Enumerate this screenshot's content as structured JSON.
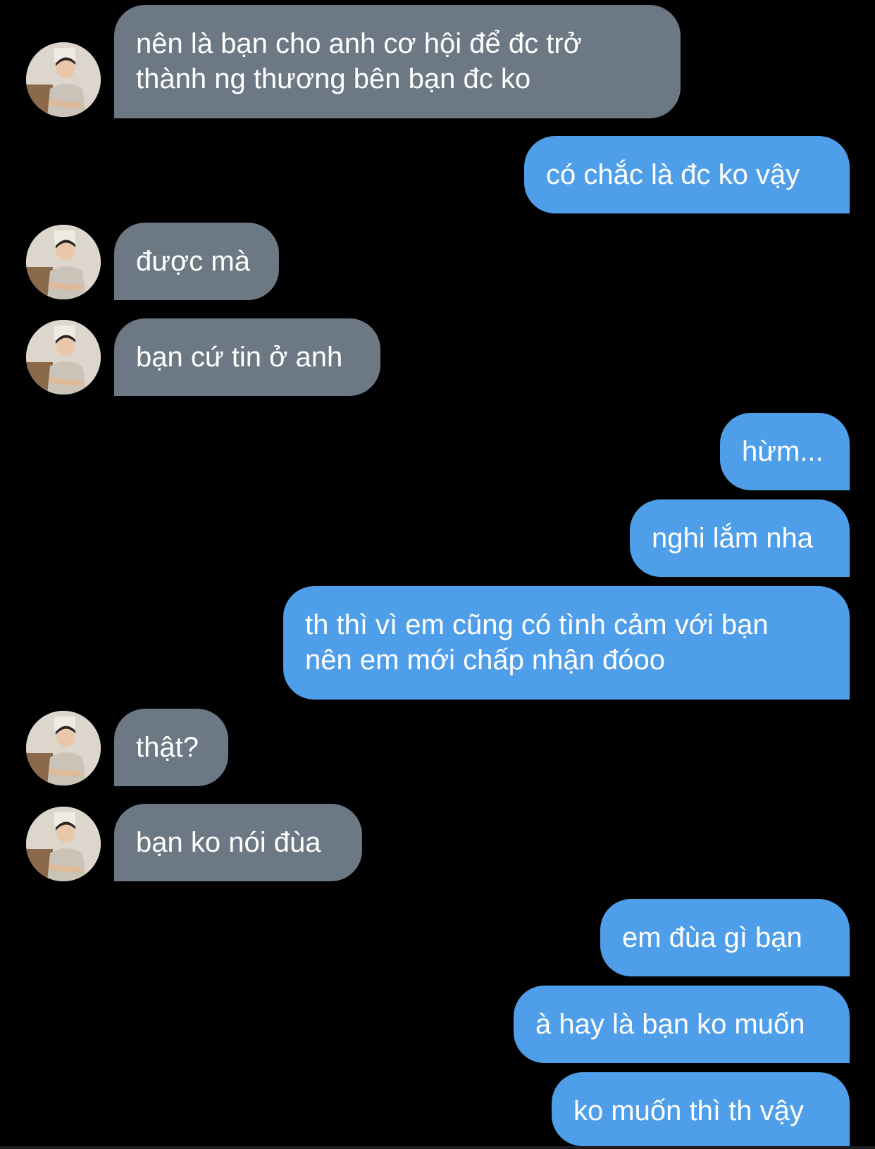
{
  "conversation": {
    "avatar_icon": "person-photo-icon",
    "colors": {
      "background": "#000000",
      "incoming_bubble": "#6d7885",
      "outgoing_bubble": "#4e9eea",
      "text": "#ffffff"
    },
    "messages": [
      {
        "sender": "them",
        "lines": [
          "nên là bạn cho anh cơ hội để đc trở",
          "thành ng thương bên bạn đc ko"
        ]
      },
      {
        "sender": "me",
        "lines": [
          "có chắc là đc ko vậy"
        ]
      },
      {
        "sender": "them",
        "lines": [
          "được mà"
        ]
      },
      {
        "sender": "them",
        "lines": [
          "bạn cứ tin ở anh"
        ]
      },
      {
        "sender": "me",
        "lines": [
          "hừm..."
        ]
      },
      {
        "sender": "me",
        "lines": [
          "nghi lắm nha"
        ]
      },
      {
        "sender": "me",
        "lines": [
          "th thì vì em cũng có tình cảm với bạn",
          "nên em mới chấp nhận đóoo"
        ]
      },
      {
        "sender": "them",
        "lines": [
          "thật?"
        ]
      },
      {
        "sender": "them",
        "lines": [
          "bạn ko nói đùa"
        ]
      },
      {
        "sender": "me",
        "lines": [
          "em đùa gì bạn"
        ]
      },
      {
        "sender": "me",
        "lines": [
          "à hay là bạn ko muốn"
        ]
      },
      {
        "sender": "me",
        "lines": [
          "ko muốn thì th vậy"
        ]
      }
    ]
  }
}
